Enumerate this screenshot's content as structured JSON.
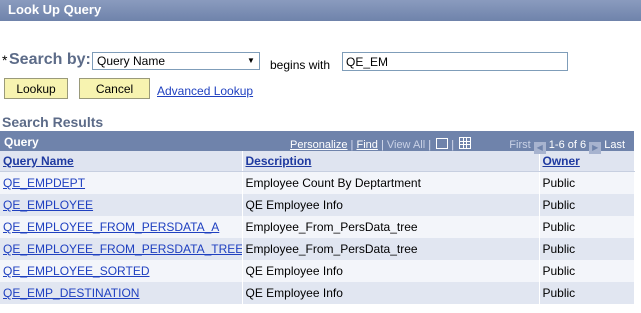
{
  "page": {
    "title": "Look Up Query"
  },
  "search": {
    "required_marker": "*",
    "label": "Search by:",
    "field": "Query Name",
    "operator": "begins with",
    "value": "QE_EM"
  },
  "buttons": {
    "lookup": "Lookup",
    "cancel": "Cancel",
    "advanced": "Advanced Lookup"
  },
  "results": {
    "title": "Search Results",
    "grid_caption": "Query",
    "nav": {
      "personalize": "Personalize",
      "find": "Find",
      "view_all": "View All",
      "first": "First",
      "range": "1-6 of 6",
      "last": "Last"
    },
    "columns": [
      "Query Name",
      "Description",
      "Owner"
    ],
    "rows": [
      {
        "name": "QE_EMPDEPT",
        "desc": "Employee Count By Deptartment",
        "owner": "Public"
      },
      {
        "name": "QE_EMPLOYEE",
        "desc": "QE Employee Info",
        "owner": "Public"
      },
      {
        "name": "QE_EMPLOYEE_FROM_PERSDATA_A",
        "desc": "Employee_From_PersData_tree",
        "owner": "Public"
      },
      {
        "name": "QE_EMPLOYEE_FROM_PERSDATA_TREE",
        "desc": "Employee_From_PersData_tree",
        "owner": "Public"
      },
      {
        "name": "QE_EMPLOYEE_SORTED",
        "desc": "QE Employee Info",
        "owner": "Public"
      },
      {
        "name": "QE_EMP_DESTINATION",
        "desc": "QE Employee Info",
        "owner": "Public"
      }
    ]
  }
}
